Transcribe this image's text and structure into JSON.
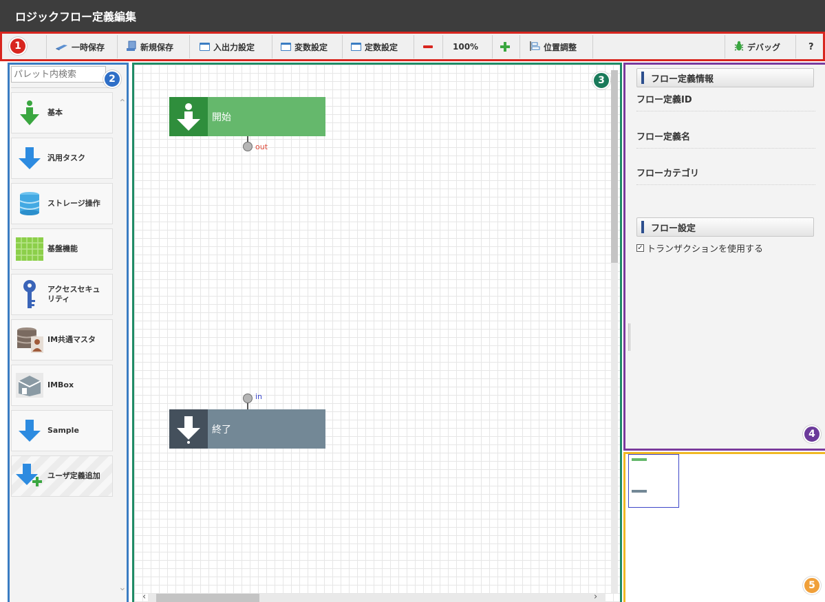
{
  "window": {
    "title": "ロジックフロー定義編集"
  },
  "toolbar": {
    "temp_save": "一時保存",
    "new_save": "新規保存",
    "io_settings": "入出力設定",
    "var_settings": "変数設定",
    "const_settings": "定数設定",
    "zoom": "100%",
    "position_adjust": "位置調整",
    "debug": "デバッグ",
    "help": "?"
  },
  "badges": {
    "b1": "1",
    "b2": "2",
    "b3": "3",
    "b4": "4",
    "b5": "5"
  },
  "badge_colors": {
    "b1": "#d8261f",
    "b2": "#2f6fc7",
    "b3": "#1a7a5a",
    "b4": "#6b3a9a",
    "b5": "#f0a03a"
  },
  "palette": {
    "search_placeholder": "パレット内検索",
    "items": [
      {
        "label": "基本",
        "icon": "green-arrow-down-icon"
      },
      {
        "label": "汎用タスク",
        "icon": "blue-arrow-down-icon"
      },
      {
        "label": "ストレージ操作",
        "icon": "storage-cylinder-icon"
      },
      {
        "label": "基盤機能",
        "icon": "green-grid-icon"
      },
      {
        "label": "アクセスセキュリティ",
        "icon": "key-icon"
      },
      {
        "label": "IM共通マスタ",
        "icon": "database-user-icon"
      },
      {
        "label": "IMBox",
        "icon": "box-icon"
      },
      {
        "label": "Sample",
        "icon": "blue-arrow-down-icon"
      },
      {
        "label": "ユーザ定義追加",
        "icon": "add-user-defined-icon"
      }
    ]
  },
  "canvas": {
    "start_node": {
      "label": "開始",
      "port": "out"
    },
    "end_node": {
      "label": "終了",
      "port": "in"
    }
  },
  "properties": {
    "flow_info_header": "フロー定義情報",
    "flow_id_label": "フロー定義ID",
    "flow_name_label": "フロー定義名",
    "flow_category_label": "フローカテゴリ",
    "flow_settings_header": "フロー設定",
    "use_transaction_label": "トランザクションを使用する",
    "use_transaction_checked": true
  },
  "colors": {
    "title_bg": "#3d3d3d",
    "toolbar_border": "#d8261f",
    "palette_border": "#3a7cc2",
    "canvas_border": "#1f8b66",
    "props_border": "#7a3a9c",
    "overview_border": "#f0b822",
    "start_node": "#65b86c",
    "end_node": "#738896"
  }
}
